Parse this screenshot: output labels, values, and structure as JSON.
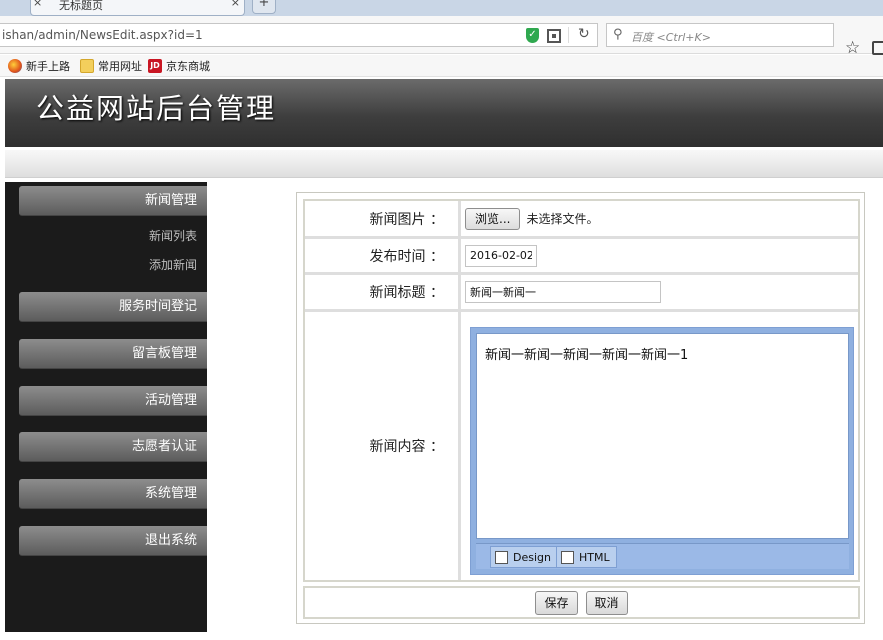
{
  "browser": {
    "tab_title": "无标题页",
    "tab_close": "×",
    "new_tab": "+",
    "url": "ishan/admin/NewsEdit.aspx?id=1",
    "search_placeholder": "百度 <Ctrl+K>",
    "bookmarks": [
      {
        "label": "新手上路",
        "icon": "firefox-icon"
      },
      {
        "label": "常用网址",
        "icon": "folder-icon"
      },
      {
        "label": "京东商城",
        "icon": "jd-icon",
        "icon_text": "JD"
      }
    ]
  },
  "header": {
    "title": "公益网站后台管理"
  },
  "sidebar": {
    "sections": [
      {
        "label": "新闻管理",
        "subitems": [
          "新闻列表",
          "添加新闻"
        ]
      },
      {
        "label": "服务时间登记"
      },
      {
        "label": "留言板管理"
      },
      {
        "label": "活动管理"
      },
      {
        "label": "志愿者认证"
      },
      {
        "label": "系统管理"
      },
      {
        "label": "退出系统"
      }
    ]
  },
  "form": {
    "image_label": "新闻图片 ：",
    "browse_button": "浏览...",
    "no_file_text": "未选择文件。",
    "date_label": "发布时间 ：",
    "date_value": "2016-02-02",
    "title_label": "新闻标题 ：",
    "title_value": "新闻一新闻一",
    "content_label": "新闻内容 ：",
    "content_value": "新闻一新闻一新闻一新闻一新闻一1",
    "editor_tabs": [
      "Design",
      "HTML"
    ],
    "save_button": "保存",
    "cancel_button": "取消"
  },
  "colors": {
    "header_bg": "#3e3e3e",
    "sidebar_bg": "#1b1b1b",
    "editor_frame": "#8fb0e0"
  }
}
